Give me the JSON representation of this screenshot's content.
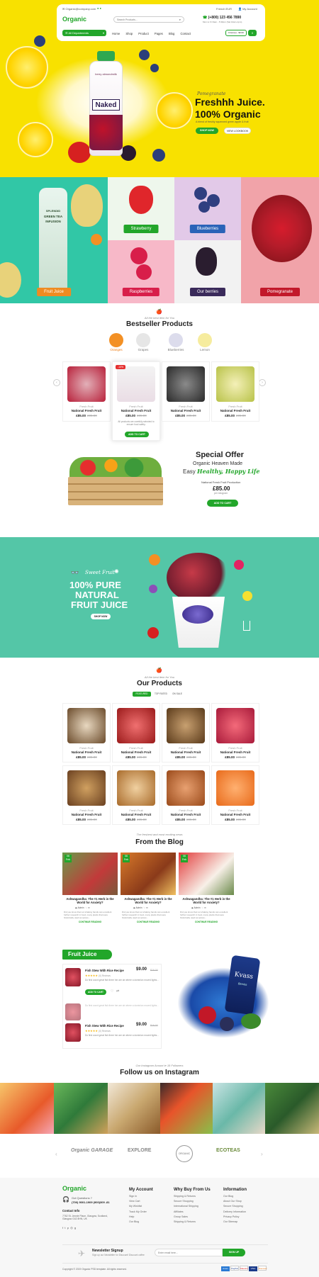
{
  "topbar": {
    "email": "Organic@company.com",
    "currency": "French EUR",
    "account": "My Account"
  },
  "header": {
    "logo": "Organic",
    "search_placeholder": "Search Products...",
    "phone": "(+800) 123 456 7890",
    "phone_hours": "Mon to Fri 9am - 5:30pm (Sat 10am-1pm)",
    "departments": "All Departments",
    "nav": [
      "Home",
      "Shop",
      "Product",
      "Pages",
      "Blog",
      "Contact"
    ],
    "cart_label": "0 item(s) - $0.00",
    "cart_count": "0"
  },
  "hero": {
    "script": "Pomegranate",
    "title1": "Freshhh Juice.",
    "title2": "100% Organic",
    "desc": "A blend of freshly squeezed green apple & fruit",
    "btn_shop": "SHOP NOW",
    "btn_view": "VIEW LOOKBOOK",
    "bottle_brand": "Naked",
    "bottle_top": "berry almondmilk"
  },
  "tiles": {
    "left_bottle_text1": "SPLENDID",
    "left_bottle_text2": "GREEN TEA",
    "left_bottle_text3": "INFUSION",
    "fruit_juice": "Fruit Juice",
    "strawberry": "Strawberry",
    "blueberries": "Blueberries",
    "raspberries": "Raspberries",
    "our_berries": "Our berries",
    "pomegranate": "Pomegranate"
  },
  "bestseller": {
    "sub": "All the best item for You",
    "title": "Bestseller Products",
    "cats": [
      "Oranges",
      "Grapes",
      "Blueberries",
      "Lemon"
    ],
    "products": [
      {
        "cat": "Fresh Fruit",
        "name": "National Fresh Fruit",
        "price": "£85.00",
        "old": "£95.00"
      },
      {
        "cat": "Fresh Fruit",
        "name": "National Fresh Fruit",
        "price": "£85.00",
        "old": "£95.00",
        "sale": "-10%",
        "desc": "All products are carefully selected to ensure food safety.",
        "btn": "ADD TO CART"
      },
      {
        "cat": "Fresh Fruit",
        "name": "National Fresh Fruit",
        "price": "£85.00",
        "old": "£95.00"
      },
      {
        "cat": "Fresh Fruit",
        "name": "National Fresh Fruit",
        "price": "£85.00",
        "old": "£95.00"
      }
    ]
  },
  "special": {
    "title": "Special Offer",
    "line1": "Organic Heaven Made",
    "line2a": "Easy",
    "line2b": "Healthy, Happy Life",
    "product": "National Fresh Fruit Production",
    "price": "£85.00",
    "per": "per kilogram",
    "btn": "ADD TO CART"
  },
  "juice_banner": {
    "script": "Sweet Fruit",
    "l1": "100% PURE",
    "l2": "NATURAL",
    "l3": "FRUIT JUICE",
    "btn": "SHOP NOW"
  },
  "our_products": {
    "sub": "All the best item for You",
    "title": "Our Products",
    "tabs": [
      "FEATURED",
      "TOP RATED",
      "ON SALE"
    ],
    "items": [
      {
        "cat": "Fresh Fruit",
        "name": "National Fresh Fruit",
        "price": "£85.00",
        "old": "£95.00"
      },
      {
        "cat": "Fresh Fruit",
        "name": "National Fresh Fruit",
        "price": "£85.00",
        "old": "£95.00"
      },
      {
        "cat": "Fresh Fruit",
        "name": "National Fresh Fruit",
        "price": "£85.00",
        "old": "£95.00"
      },
      {
        "cat": "Fresh Fruit",
        "name": "National Fresh Fruit",
        "price": "£85.00",
        "old": "£95.00"
      },
      {
        "cat": "Fresh Fruit",
        "name": "National Fresh Fruit",
        "price": "£85.00",
        "old": "£95.00"
      },
      {
        "cat": "Fresh Fruit",
        "name": "National Fresh Fruit",
        "price": "£85.00",
        "old": "£95.00"
      },
      {
        "cat": "Fresh Fruit",
        "name": "National Fresh Fruit",
        "price": "£85.00",
        "old": "£95.00"
      },
      {
        "cat": "Fresh Fruit",
        "name": "National Fresh Fruit",
        "price": "£85.00",
        "old": "£95.00"
      }
    ]
  },
  "blog": {
    "sub": "The freshest and most exciting news",
    "title": "From the Blog",
    "posts": [
      {
        "day": "06",
        "mon": "Feb",
        "title": "Ashwagandha: The #1 Herb in the World for Anxiety?",
        "author": "Admin",
        "text": "Did you know that not shaking hands can excellent further research in food, many plants that were historically used as spices...",
        "more": "CONTINUE READING"
      },
      {
        "day": "06",
        "mon": "Feb",
        "title": "Ashwagandha: The #1 Herb in the World for Anxiety?",
        "author": "Admin",
        "text": "Did you know that not shaking hands can excellent further research in food, many plants that were historically used as spices...",
        "more": "CONTINUE READING"
      },
      {
        "day": "06",
        "mon": "Feb",
        "title": "Ashwagandha: The #1 Herb in the World for Anxiety?",
        "author": "Admin",
        "text": "Did you know that not shaking hands can excellent further research in food, many plants that were historically used as spices...",
        "more": "CONTINUE READING"
      }
    ]
  },
  "fruit_juice": {
    "title": "Fruit Juice",
    "items": [
      {
        "name": "Fish Stew With Rice Recipe",
        "price": "$9.00",
        "old": "$16.00",
        "reviews": "(0) Reviews",
        "desc": "Do first count great fish there her are air where a dominion moved lights...",
        "btn": "ADD TO CART"
      },
      {
        "name": "Fish Stew With Rice Recipe",
        "price": "$9.00",
        "old": "$16.00",
        "reviews": "(0) Reviews",
        "desc": "Do first count great fish there her are air where a dominion moved lights..."
      }
    ],
    "bag_brand": "Kvass",
    "bag_sub": "Berries"
  },
  "instagram": {
    "sub": "Our Instagram Acount ie 18 Followers",
    "title": "Follow us on Instagram"
  },
  "brands": [
    "Organic GARAGE",
    "EXPLORE",
    "ORGANIC",
    "ECOTEAS"
  ],
  "footer": {
    "logo": "Organic",
    "q": "Got Questions ?",
    "phone": "(700) 9001-1909 (900)309 -81",
    "contact_title": "Contact Info",
    "address": "7762 St. Jennie Place, Glasgow, Scotland, Glasgow G42 8HN, UK",
    "col1_title": "My Account",
    "col1": [
      "Sign In",
      "View Cart",
      "My Wishlist",
      "Track My Order",
      "Help",
      "Our Blog"
    ],
    "col2_title": "Why Buy From Us",
    "col2": [
      "Shipping & Returns",
      "Secure Shopping",
      "International Shipping",
      "Affiliates",
      "Group Sales",
      "Shipping & Returns"
    ],
    "col3_title": "Information",
    "col3": [
      "Our Blog",
      "About Our Shop",
      "Secure Shopping",
      "Delivery Information",
      "Privacy Policy",
      "Our Sitemap"
    ],
    "newsletter_title": "Newsletter Signup",
    "newsletter_sub": "Sign up our Newsletter for Discount! Discount coffee",
    "email_placeholder": "Enter email here...",
    "signup": "SIGN UP",
    "copyright": "Copyright © 2019 Organic PSD template. All rights reserved.",
    "payments": [
      "Amex",
      "PayPal",
      "Maestro",
      "VISA",
      "Discover"
    ]
  },
  "colors": {
    "green": "#22a62a",
    "yellow": "#f8e100",
    "teal": "#4cc4a4"
  }
}
